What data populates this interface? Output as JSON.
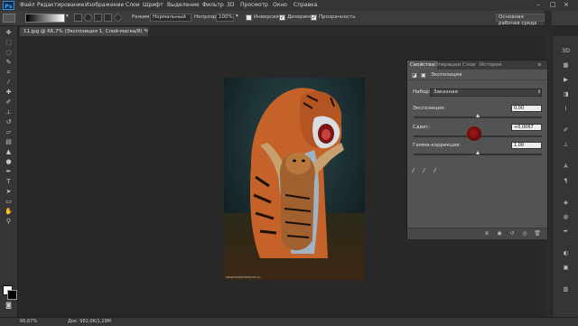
{
  "app": {
    "logo": "Ps"
  },
  "menu": [
    "Файл",
    "Редактирование",
    "Изображение",
    "Слои",
    "Шрифт",
    "Выделение",
    "Фильтр",
    "3D",
    "Просмотр",
    "Окно",
    "Справка"
  ],
  "options": {
    "mode_label": "Режим:",
    "mode_value": "Нормальный",
    "opacity_label": "Непрозр.:",
    "opacity_value": "100%",
    "inversion": "Инверсия",
    "dither": "Дизеринг",
    "transparency": "Прозрачность",
    "workspace": "Основная рабочая среда"
  },
  "document": {
    "tab": "11.jpg @ 66,7% (Экспозиция 1, Слой-маска/8) *",
    "close": "×",
    "caption": "www.bestreference.ru"
  },
  "status": {
    "zoom": "66,67%",
    "doc": "Док: 982,0K/1,29M"
  },
  "panel": {
    "tabs": [
      "Свойства",
      "Операции",
      "Слои",
      "История"
    ],
    "subtitle": "Экспозиция",
    "preset_label": "Набор:",
    "preset_value": "Заказная",
    "exposure_label": "Экспозиция:",
    "exposure_value": "0,00",
    "offset_label": "Сдвиг:",
    "offset_value": "+0,0067",
    "gamma_label": "Гамма-коррекция:",
    "gamma_value": "1,00",
    "exposure_level": 0.5,
    "offset_level": 0.5,
    "gamma_level": 0.5
  },
  "colors": {
    "accent": "#2f8fd8",
    "panel": "#535353",
    "background": "#282828"
  },
  "icons": {
    "tools": [
      "move-icon",
      "marquee-icon",
      "lasso-icon",
      "quick-select-icon",
      "crop-icon",
      "eyedropper-icon",
      "healing-icon",
      "brush-icon",
      "stamp-icon",
      "history-brush-icon",
      "eraser-icon",
      "gradient-icon",
      "blur-icon",
      "dodge-icon",
      "pen-icon",
      "type-icon",
      "path-select-icon",
      "shape-icon",
      "hand-icon",
      "zoom-icon"
    ],
    "dock": [
      "3d-icon",
      "history-icon",
      "actions-icon",
      "properties-icon",
      "info-icon",
      "brush-panel-icon",
      "clone-source-icon",
      "character-icon",
      "paragraph-icon",
      "layers-icon",
      "channels-icon",
      "paths-icon"
    ],
    "eyedroppers": [
      "eyedropper-black-icon",
      "eyedropper-gray-icon",
      "eyedropper-white-icon"
    ]
  }
}
